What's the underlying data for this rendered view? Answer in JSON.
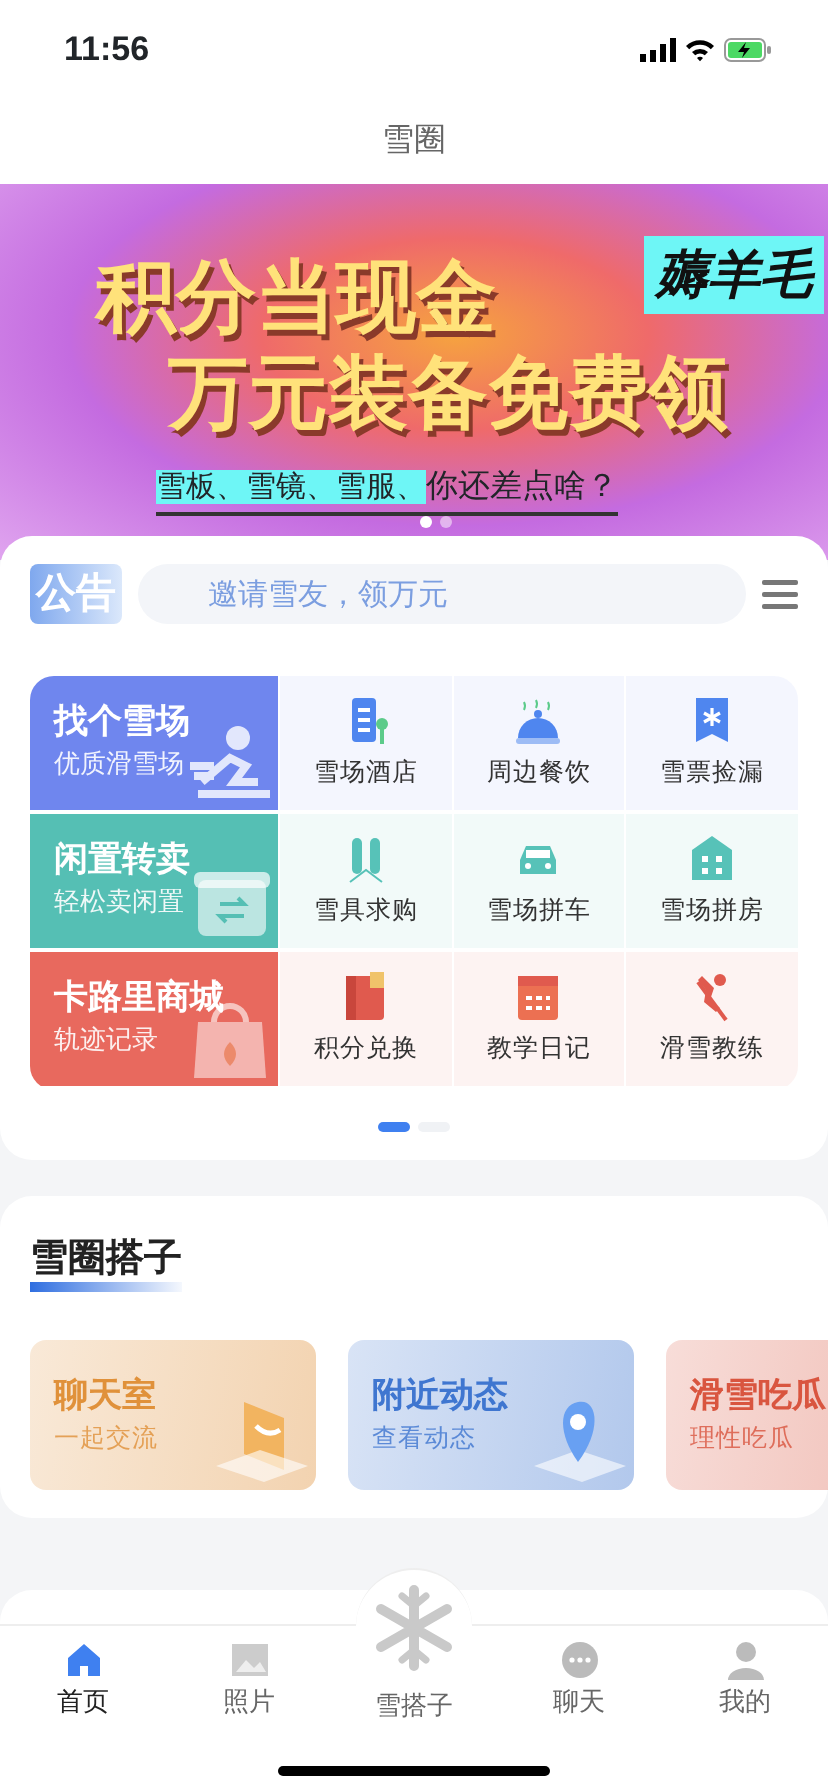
{
  "status_bar": {
    "time": "11:56"
  },
  "nav": {
    "title": "雪圈"
  },
  "banner": {
    "tag": "薅羊毛",
    "headlines": [
      "积分当现金",
      "万元装备免费领"
    ],
    "subtitle_highlight": "雪板、雪镜、雪服、",
    "subtitle": "你还差点啥？",
    "dots": [
      {
        "selected": true
      },
      {
        "selected": false
      }
    ]
  },
  "notice": {
    "label": "公告",
    "placeholder": "邀请雪友，领万元"
  },
  "grid": [
    {
      "title": "找个雪场",
      "subtitle": "优质滑雪场",
      "color": "#6f86ee",
      "items": [
        "雪场酒店",
        "周边餐饮",
        "雪票捡漏"
      ]
    },
    {
      "title": "闲置转卖",
      "subtitle": "轻松卖闲置",
      "color": "#55bfb4",
      "items": [
        "雪具求购",
        "雪场拼车",
        "雪场拼房"
      ]
    },
    {
      "title": "卡路里商城",
      "subtitle": "轨迹记录",
      "color": "#e8695e",
      "items": [
        "积分兑换",
        "教学日记",
        "滑雪教练"
      ]
    }
  ],
  "grid_pages": [
    {
      "selected": true
    },
    {
      "selected": false
    }
  ],
  "section": {
    "title": "雪圈搭子",
    "cards": [
      {
        "title": "聊天室",
        "subtitle": "一起交流",
        "color": "#e0913a"
      },
      {
        "title": "附近动态",
        "subtitle": "查看动态",
        "color": "#3f76d0"
      },
      {
        "title": "滑雪吃瓜",
        "subtitle": "理性吃瓜",
        "color": "#d9553f"
      }
    ]
  },
  "tab_bar": [
    {
      "label": "首页",
      "selected": true,
      "kind": "plain"
    },
    {
      "label": "照片",
      "selected": false,
      "kind": "plain"
    },
    {
      "label": "雪搭子",
      "selected": false,
      "kind": "raised"
    },
    {
      "label": "聊天",
      "selected": false,
      "kind": "plain"
    },
    {
      "label": "我的",
      "selected": false,
      "kind": "plain"
    }
  ]
}
